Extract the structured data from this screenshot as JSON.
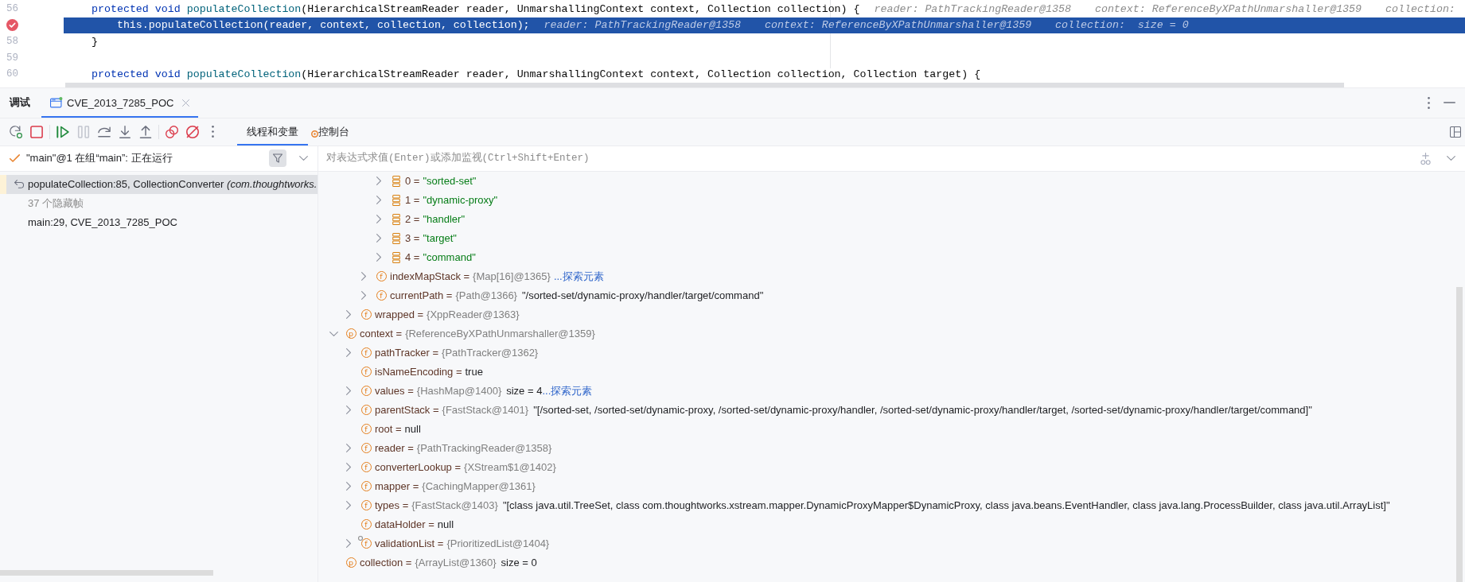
{
  "editor": {
    "lines": [
      {
        "number": "56",
        "current": false,
        "breakpoint": false,
        "tokens": [
          {
            "kind": "keyword",
            "text": "protected void "
          },
          {
            "kind": "method",
            "text": "populateCollection"
          },
          {
            "kind": "plain",
            "text": "(HierarchicalStreamReader reader, UnmarshallingContext context, Collection collection) {"
          }
        ],
        "hints": [
          "reader: PathTrackingReader@1358",
          "context: ReferenceByXPathUnmarshaller@1359",
          "collection:"
        ]
      },
      {
        "current": true,
        "breakpoint": true,
        "tokens": [
          {
            "kind": "keyword",
            "text": "    this"
          },
          {
            "kind": "plain",
            "text": "."
          },
          {
            "kind": "method",
            "text": "populateCollection"
          },
          {
            "kind": "plain",
            "text": "(reader, context, collection, collection);"
          }
        ],
        "hints": [
          "reader: PathTrackingReader@1358",
          "context: ReferenceByXPathUnmarshaller@1359",
          "collection:  size = 0"
        ]
      },
      {
        "number": "58",
        "current": false,
        "breakpoint": false,
        "tokens": [
          {
            "kind": "plain",
            "text": "}"
          }
        ]
      },
      {
        "number": "59",
        "current": false,
        "breakpoint": false
      },
      {
        "number": "60",
        "current": false,
        "breakpoint": false,
        "tokens": [
          {
            "kind": "keyword",
            "text": "protected void "
          },
          {
            "kind": "method",
            "text": "populateCollection"
          },
          {
            "kind": "plain",
            "text": "(HierarchicalStreamReader reader, UnmarshallingContext context, Collection collection, Collection target) {"
          }
        ]
      }
    ]
  },
  "debug": {
    "title": "调试",
    "tabs": [
      {
        "label": "CVE_2013_7285_POC",
        "selected": true
      }
    ],
    "toolbar": [
      {
        "buttons": [
          {
            "kind": "rerun",
            "disabled": false
          },
          {
            "kind": "stop",
            "disabled": false
          }
        ]
      },
      {
        "buttons": [
          {
            "kind": "resume",
            "disabled": false
          },
          {
            "kind": "pause",
            "disabled": true
          },
          {
            "kind": "step_over",
            "disabled": false
          },
          {
            "kind": "step_into",
            "disabled": false
          },
          {
            "kind": "step_out",
            "disabled": false
          }
        ]
      },
      {
        "buttons": [
          {
            "kind": "view_breakpoints",
            "disabled": false
          },
          {
            "kind": "mute_breakpoints",
            "disabled": false
          },
          {
            "kind": "more",
            "disabled": false
          }
        ]
      }
    ],
    "view_tabs": [
      {
        "label": "线程和变量",
        "selected": true,
        "notification": false
      },
      {
        "label": "控制台",
        "selected": false,
        "notification": true
      }
    ],
    "thread": {
      "label": "\"main\"@1 在组“main”: 正在运行"
    },
    "frames": [
      {
        "kind": "current",
        "selected": true,
        "label": "populateCollection:85, CollectionConverter *(com.thoughtworks.*"
      },
      {
        "kind": "hidden",
        "selected": false,
        "label": "37 个隐藏帧"
      },
      {
        "kind": "frame",
        "selected": false,
        "label": "main:29, CVE_2013_7285_POC"
      }
    ],
    "evaluate": {
      "placeholder": "对表达式求值(Enter)或添加监视(Ctrl+Shift+Enter)"
    },
    "variables": [
      {
        "children": [
          {
            "children": [
              {
                "children": [
                  {
                    "kind": "element",
                    "expanded": false,
                    "name": "0 =",
                    "value": "\"sorted-set\""
                  },
                  {
                    "kind": "element",
                    "expanded": false,
                    "name": "1 =",
                    "value": "\"dynamic-proxy\""
                  },
                  {
                    "kind": "element",
                    "expanded": false,
                    "name": "2 =",
                    "value": "\"handler\""
                  },
                  {
                    "kind": "element",
                    "expanded": false,
                    "name": "3 =",
                    "value": "\"target\""
                  },
                  {
                    "kind": "element",
                    "expanded": false,
                    "name": "4 =",
                    "value": "\"command\""
                  }
                ]
              },
              {
                "kind": "field",
                "badge": "f",
                "expanded": false,
                "name": "indexMapStack =",
                "type": "{Map[16]@1365}",
                "link": "...探索元素"
              },
              {
                "kind": "field",
                "badge": "f",
                "expanded": false,
                "name": "currentPath =",
                "type": "{Path@1366}",
                "value": "\"/sorted-set/dynamic-proxy/handler/target/command\""
              }
            ]
          },
          {
            "kind": "field",
            "badge": "f",
            "expanded": false,
            "name": "wrapped =",
            "type": "{XppReader@1363}"
          }
        ]
      },
      {
        "kind": "parameter",
        "badge": "p",
        "expanded": true,
        "name": "context =",
        "type": "{ReferenceByXPathUnmarshaller@1359}",
        "children": [
          {
            "kind": "field",
            "badge": "f",
            "expanded": false,
            "name": "pathTracker =",
            "type": "{PathTracker@1362}"
          },
          {
            "kind": "field",
            "badge": "f",
            "name": "isNameEncoding =",
            "value": "true"
          },
          {
            "kind": "field",
            "badge": "f",
            "expanded": false,
            "name": "values =",
            "type": "{HashMap@1400}",
            "value": "size = 4",
            "link": "...探索元素"
          },
          {
            "kind": "field",
            "badge": "f",
            "expanded": false,
            "name": "parentStack =",
            "type": "{FastStack@1401}",
            "value": "\"[/sorted-set, /sorted-set/dynamic-proxy, /sorted-set/dynamic-proxy/handler, /sorted-set/dynamic-proxy/handler/target, /sorted-set/dynamic-proxy/handler/target/command]\""
          },
          {
            "kind": "field",
            "badge": "f",
            "name": "root =",
            "value": "null"
          },
          {
            "kind": "field",
            "badge": "f",
            "expanded": false,
            "name": "reader =",
            "type": "{PathTrackingReader@1358}"
          },
          {
            "kind": "field",
            "badge": "f",
            "expanded": false,
            "name": "converterLookup =",
            "type": "{XStream$1@1402}"
          },
          {
            "kind": "field",
            "badge": "f",
            "expanded": false,
            "name": "mapper =",
            "type": "{CachingMapper@1361}"
          },
          {
            "kind": "field",
            "badge": "f",
            "expanded": false,
            "name": "types =",
            "type": "{FastStack@1403}",
            "value": "\"[class java.util.TreeSet, class com.thoughtworks.xstream.mapper.DynamicProxyMapper$DynamicProxy, class java.beans.EventHandler, class java.lang.ProcessBuilder, class java.util.ArrayList]\""
          },
          {
            "kind": "field",
            "badge": "f",
            "name": "dataHolder =",
            "value": "null"
          },
          {
            "kind": "field",
            "badge": "f",
            "expanded": false,
            "overlay": true,
            "name": "validationList =",
            "type": "{PrioritizedList@1404}"
          }
        ]
      },
      {
        "kind": "parameter",
        "badge": "p",
        "name": "collection =",
        "type": "{ArrayList@1360}",
        "value": "size = 0"
      }
    ]
  }
}
